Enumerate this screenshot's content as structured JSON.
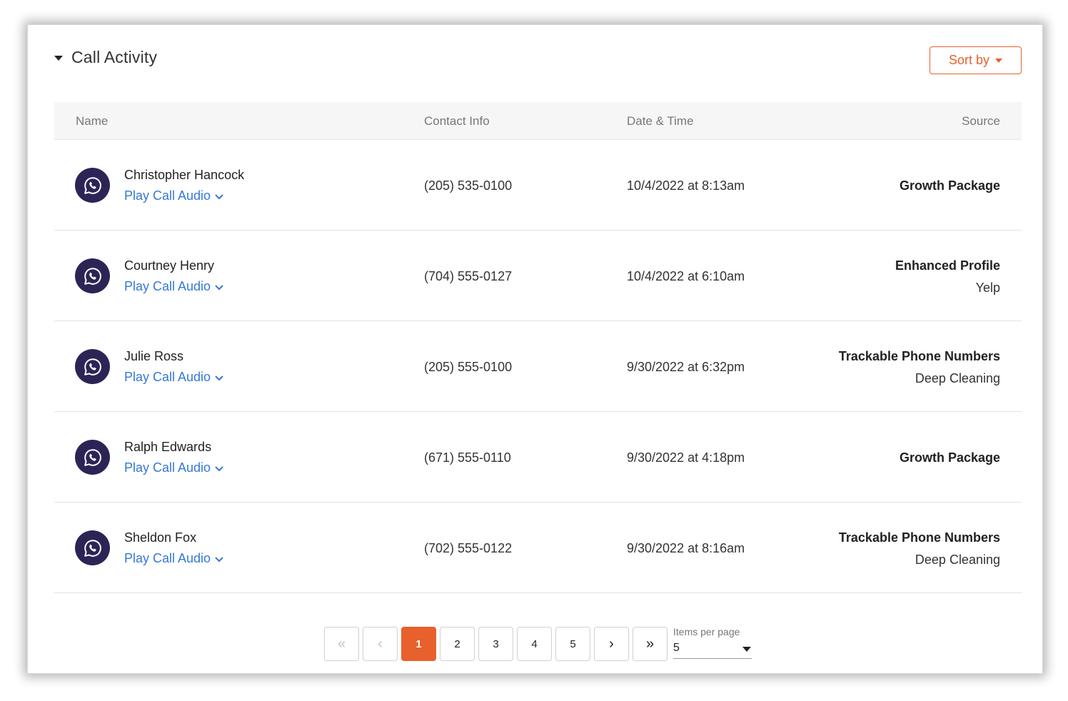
{
  "header": {
    "title": "Call Activity",
    "sort_label": "Sort by"
  },
  "table": {
    "columns": [
      "Name",
      "Contact Info",
      "Date & Time",
      "Source"
    ],
    "play_label": "Play Call Audio",
    "rows": [
      {
        "name": "Christopher Hancock",
        "contact": "(205) 535-0100",
        "datetime": "10/4/2022 at 8:13am",
        "source": "Growth Package",
        "source_sub": ""
      },
      {
        "name": "Courtney Henry",
        "contact": "(704) 555-0127",
        "datetime": "10/4/2022 at 6:10am",
        "source": "Enhanced Profile",
        "source_sub": "Yelp"
      },
      {
        "name": "Julie Ross",
        "contact": "(205) 555-0100",
        "datetime": "9/30/2022 at 6:32pm",
        "source": "Trackable Phone Numbers",
        "source_sub": "Deep Cleaning"
      },
      {
        "name": "Ralph Edwards",
        "contact": "(671) 555-0110",
        "datetime": "9/30/2022 at 4:18pm",
        "source": "Growth Package",
        "source_sub": ""
      },
      {
        "name": "Sheldon Fox",
        "contact": "(702) 555-0122",
        "datetime": "9/30/2022 at 8:16am",
        "source": "Trackable Phone Numbers",
        "source_sub": "Deep Cleaning"
      }
    ]
  },
  "pagination": {
    "first": "«",
    "prev": "‹",
    "next": "›",
    "last": "»",
    "pages": [
      "1",
      "2",
      "3",
      "4",
      "5"
    ],
    "current": "1",
    "items_per_page_label": "Items per page",
    "items_per_page_value": "5"
  },
  "colors": {
    "accent": "#e8602c",
    "link": "#3478d8",
    "avatar": "#2d2456"
  },
  "icons": {
    "avatar": "phone-chat-icon",
    "play_chevron": "chevron-down-icon",
    "collapse": "caret-down-icon"
  }
}
